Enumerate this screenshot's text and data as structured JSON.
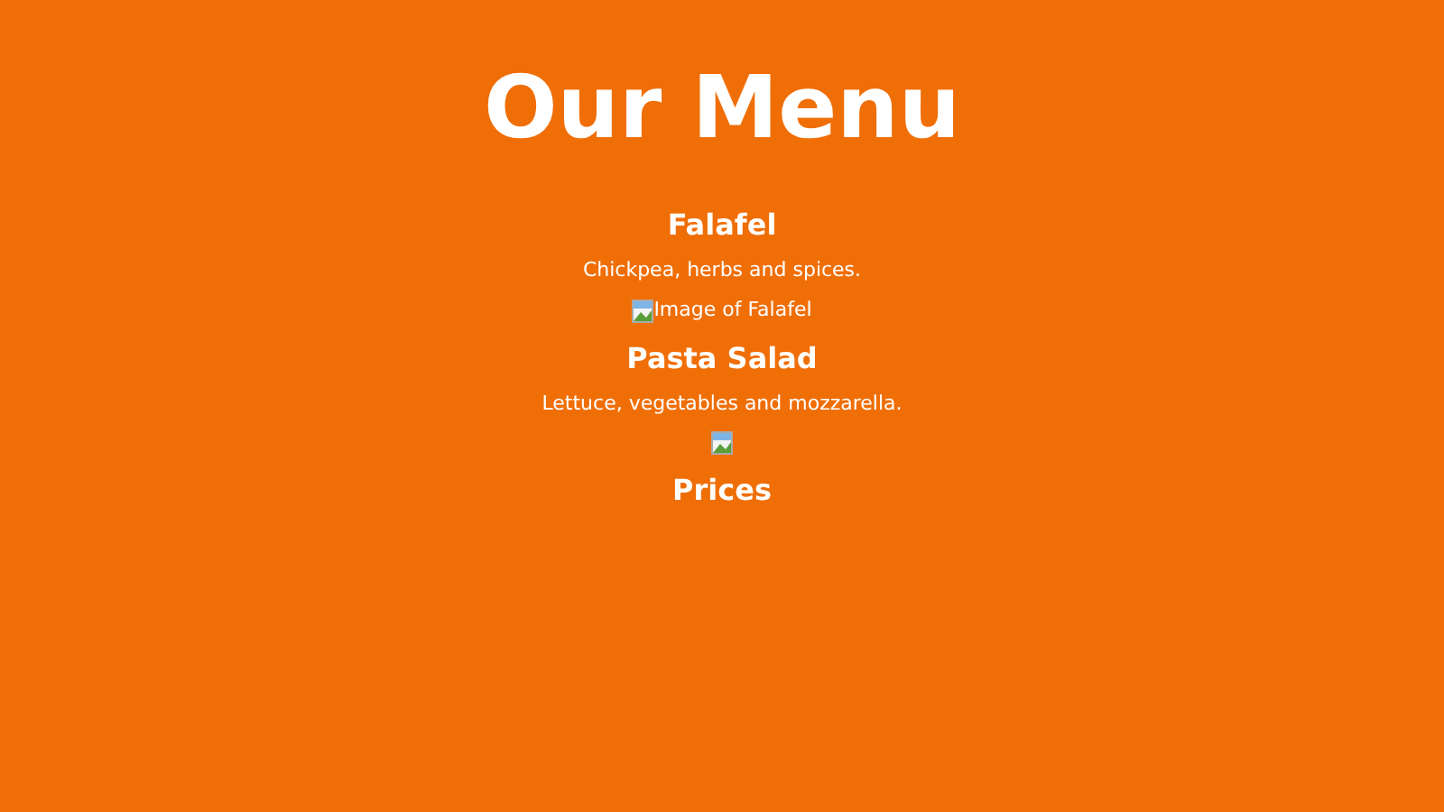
{
  "title": "Our Menu",
  "items": [
    {
      "name": "Falafel",
      "description": "Chickpea, herbs and spices.",
      "image_alt": "Image of Falafel"
    },
    {
      "name": "Pasta Salad",
      "description": "Lettuce, vegetables and mozzarella."
    }
  ],
  "section_heading": "Prices"
}
